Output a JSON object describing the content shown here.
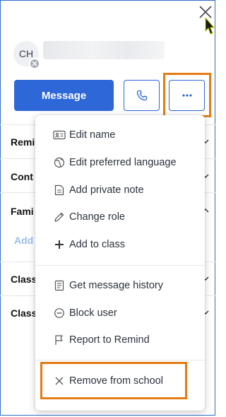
{
  "profile": {
    "avatar_initials": "CH"
  },
  "actions": {
    "message_label": "Message"
  },
  "background_sections": [
    "Remi",
    "Cont",
    "Fami",
    "Class",
    "Class"
  ],
  "background_add_link": "Add",
  "menu": {
    "group1": [
      {
        "label": "Edit name",
        "icon": "id-card-icon"
      },
      {
        "label": "Edit preferred language",
        "icon": "globe-icon"
      },
      {
        "label": "Add private note",
        "icon": "note-icon"
      },
      {
        "label": "Change role",
        "icon": "pencil-icon"
      },
      {
        "label": "Add to class",
        "icon": "plus-icon"
      }
    ],
    "group2": [
      {
        "label": "Get message history",
        "icon": "document-icon"
      },
      {
        "label": "Block user",
        "icon": "block-icon"
      },
      {
        "label": "Report to Remind",
        "icon": "flag-icon"
      }
    ],
    "group3": [
      {
        "label": "Remove from school",
        "icon": "close-x-icon"
      }
    ]
  },
  "colors": {
    "primary": "#2e67d8",
    "highlight": "#e47b13",
    "text": "#2b333d"
  }
}
